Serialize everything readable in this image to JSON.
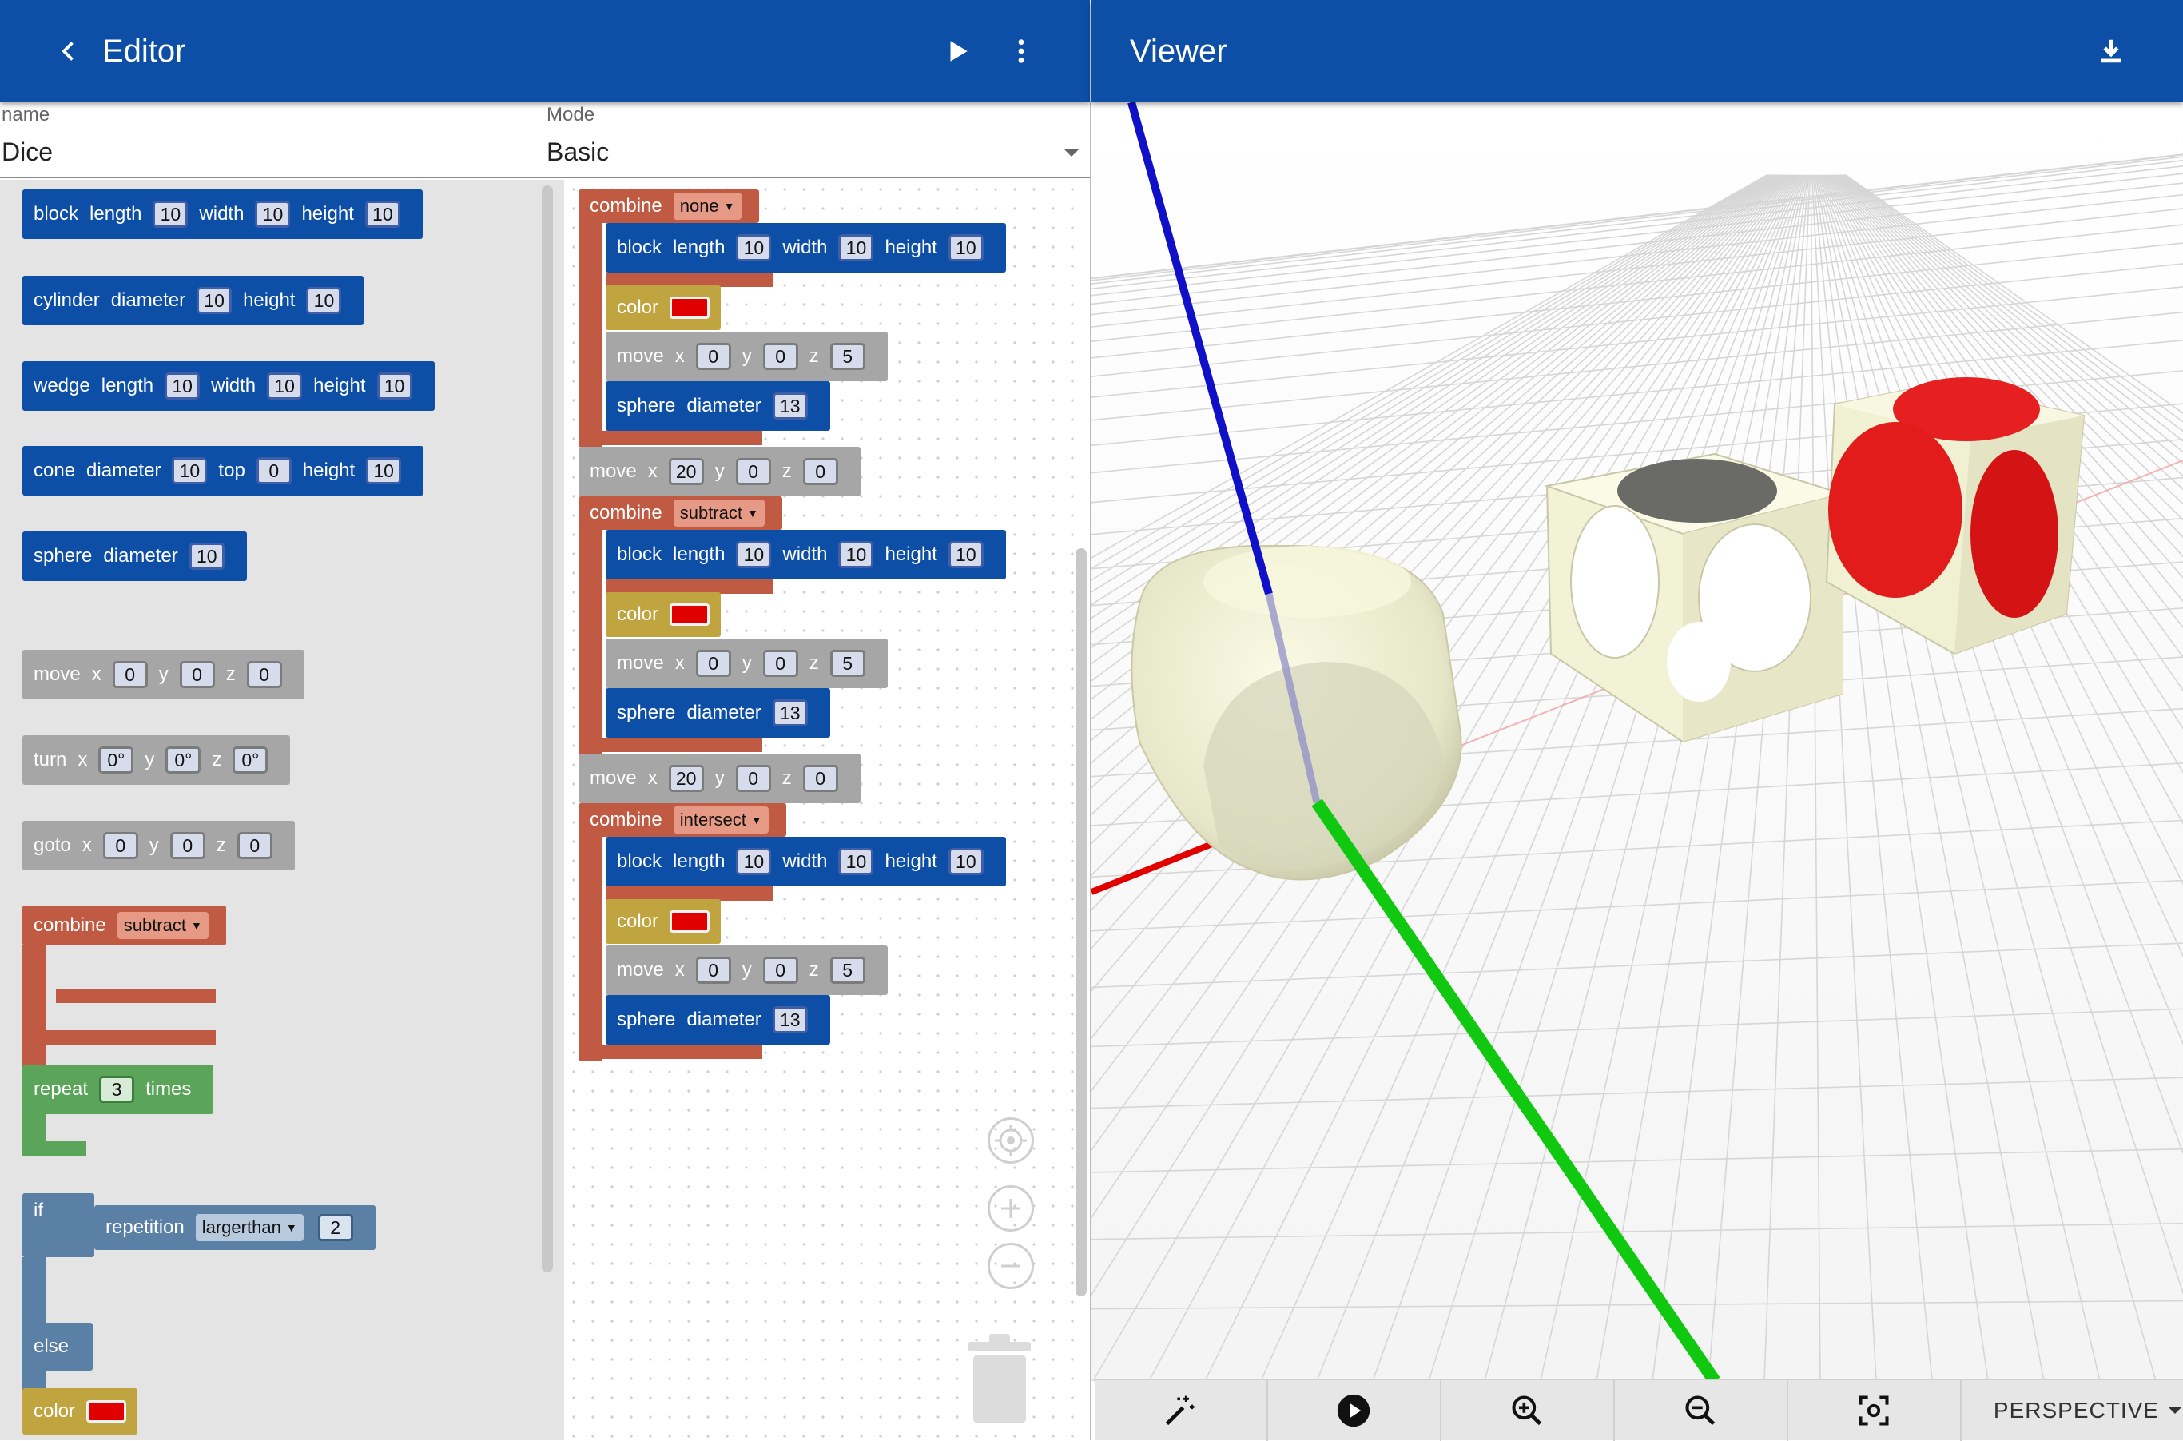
{
  "editor": {
    "title": "Editor"
  },
  "viewer": {
    "title": "Viewer",
    "projection": "PERSPECTIVE"
  },
  "form": {
    "name_label": "name",
    "name_value": "Dice",
    "mode_label": "Mode",
    "mode_value": "Basic"
  },
  "colors": {
    "appbar": "#0d4ea6",
    "block_blue": "#0d4ea6",
    "block_gray": "#a6a6a6",
    "combine": "#c05a42",
    "color_block": "#c0a43f",
    "repeat": "#5ba55b",
    "if": "#5b80a5",
    "swatch_red": "#e00000",
    "x_axis": "#e00000",
    "y_axis": "#1010c8",
    "z_axis": "#10c810"
  },
  "toolbox": {
    "block": {
      "kw": "block",
      "a": "length",
      "av": "10",
      "b": "width",
      "bv": "10",
      "c": "height",
      "cv": "10"
    },
    "cylinder": {
      "kw": "cylinder",
      "a": "diameter",
      "av": "10",
      "b": "height",
      "bv": "10"
    },
    "wedge": {
      "kw": "wedge",
      "a": "length",
      "av": "10",
      "b": "width",
      "bv": "10",
      "c": "height",
      "cv": "10"
    },
    "cone": {
      "kw": "cone",
      "a": "diameter",
      "av": "10",
      "b": "top",
      "bv": "0",
      "c": "height",
      "cv": "10"
    },
    "sphere": {
      "kw": "sphere",
      "a": "diameter",
      "av": "10"
    },
    "move": {
      "kw": "move",
      "x": "x",
      "xv": "0",
      "y": "y",
      "yv": "0",
      "z": "z",
      "zv": "0"
    },
    "turn": {
      "kw": "turn",
      "x": "x",
      "xv": "0°",
      "y": "y",
      "yv": "0°",
      "z": "z",
      "zv": "0°"
    },
    "goto": {
      "kw": "goto",
      "x": "x",
      "xv": "0",
      "y": "y",
      "yv": "0",
      "z": "z",
      "zv": "0"
    },
    "combine": {
      "kw": "combine",
      "op": "subtract"
    },
    "repeat": {
      "kw": "repeat",
      "count": "3",
      "suffix": "times"
    },
    "if": {
      "kw": "if",
      "cond": "repetition",
      "op": "largerthan",
      "val": "2",
      "else": "else"
    },
    "color": {
      "kw": "color"
    }
  },
  "program": [
    {
      "op": "none",
      "block": {
        "length": "10",
        "width": "10",
        "height": "10"
      },
      "move": {
        "x": "0",
        "y": "0",
        "z": "5"
      },
      "sphere": "13",
      "after_move": {
        "x": "20",
        "y": "0",
        "z": "0"
      }
    },
    {
      "op": "subtract",
      "block": {
        "length": "10",
        "width": "10",
        "height": "10"
      },
      "move": {
        "x": "0",
        "y": "0",
        "z": "5"
      },
      "sphere": "13",
      "after_move": {
        "x": "20",
        "y": "0",
        "z": "0"
      }
    },
    {
      "op": "intersect",
      "block": {
        "length": "10",
        "width": "10",
        "height": "10"
      },
      "move": {
        "x": "0",
        "y": "0",
        "z": "5"
      },
      "sphere": "13"
    }
  ],
  "labels": {
    "combine": "combine",
    "block": "block",
    "length": "length",
    "width": "width",
    "height": "height",
    "color": "color",
    "move": "move",
    "x": "x",
    "y": "y",
    "z": "z",
    "sphere": "sphere",
    "diameter": "diameter"
  }
}
